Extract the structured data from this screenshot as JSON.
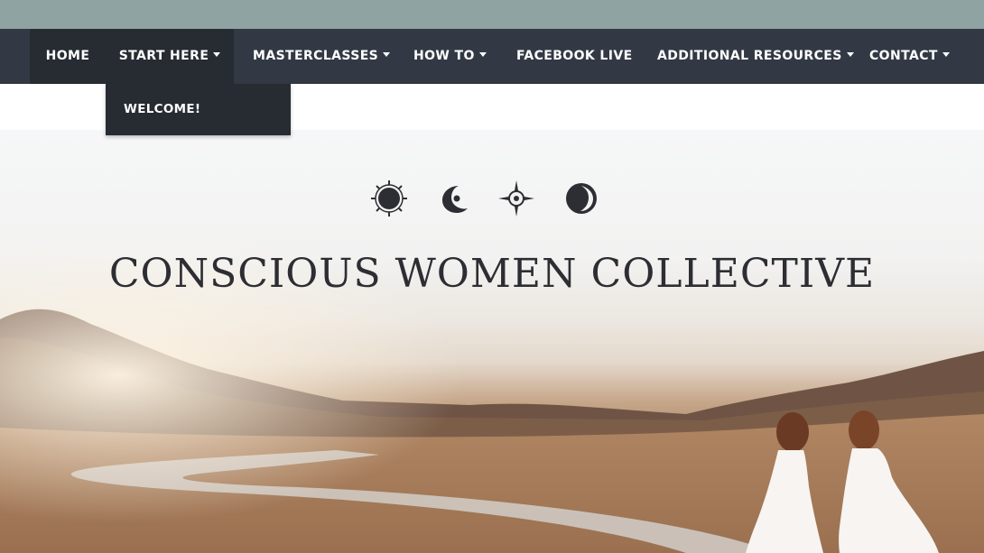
{
  "nav": {
    "items": [
      {
        "label": "HOME"
      },
      {
        "label": "START HERE"
      },
      {
        "label": "MASTERCLASSES"
      },
      {
        "label": "HOW TO"
      },
      {
        "label": "FACEBOOK LIVE"
      },
      {
        "label": "ADDITIONAL RESOURCES"
      },
      {
        "label": "CONTACT"
      }
    ],
    "dropdown": {
      "items": [
        {
          "label": "WELCOME!"
        }
      ]
    }
  },
  "hero": {
    "icons": [
      "sun-icon",
      "crescent-moon-icon",
      "star-compass-icon",
      "moon-phase-icon"
    ],
    "brand": "CONSCIOUS WOMEN COLLECTIVE"
  },
  "colors": {
    "topbar": "#8fa3a3",
    "navbar": "#333944",
    "nav_active": "#272c33",
    "nav_text": "#ffffff",
    "brand_text": "#2d2e33"
  }
}
